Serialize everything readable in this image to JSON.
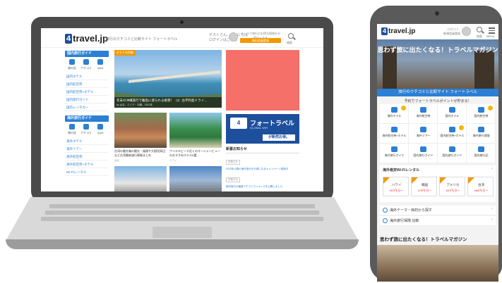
{
  "desktop": {
    "logo_box": "4",
    "logo_text": "travel.jp",
    "tagline": "旅行のクチコミと比較サイト フォートラベル",
    "user_line1": "ゲストさん、こんにちは",
    "user_line2": "ログインはこちら",
    "promo_text": "メールで旅行のお得な情報をお届けします",
    "promo_button": "無料会員登録",
    "search_label": "検索",
    "domestic_guide": "国内旅行ガイド",
    "overseas_guide": "海外旅行ガイド",
    "side_icons": [
      "旅の記",
      "クチコミ",
      "Q&A"
    ],
    "domestic_links": [
      "国内ホテル",
      "国内航空券",
      "国内航空券+ホテル",
      "国内旅行ガイド",
      "国内レンタカー"
    ],
    "overseas_links": [
      "海外ホテル",
      "海外ツアー",
      "海外航空券",
      "海外航空券+ホテル",
      "Wi-Fiレンタル"
    ],
    "hero_tag": "おすすめ特集",
    "hero_caption": "年末の沖縄旅行で離島に渡られる絶景！（3）古宇利島ドライ...",
    "hero_meta": "by はな、エリア：沖縄、2022年",
    "cards": [
      {
        "title": "台湾の最先端の観光・福建や大稲埕周辺など台湾最新旅行情報まとめ",
        "meta": "台北"
      },
      {
        "title": "ワイキキビーチ近くのオーシャンビューのおすすめホテル5選",
        "meta": "ハワイ"
      }
    ],
    "banner_logo": "4",
    "banner_title": "フォートラベル",
    "banner_subtitle": "GLOBAL WIFI",
    "banner_cta": "が断然お得。",
    "news_heading": "新着お知らせ",
    "news_tag": "お知らせ",
    "news_items": [
      "2022年以降の海外旅行がお得になるキャンペーン実施中",
      "国内旅行の最新クチコミランキングを公開しました"
    ]
  },
  "phone": {
    "logo_box": "4",
    "logo_text": "travel.jp",
    "header_login": "ログイン",
    "header_register": "新規会員登録",
    "search_label": "検索",
    "menu_label": "MENU",
    "hero_title": "思わず旅に出たくなる！トラベルマガジン",
    "sub_banner": "旅行のクチコミと比較サイト フォートラベル",
    "point_text": "予約でフォートラベルポイントが貯まる！",
    "services": [
      "海外ホテル",
      "海外航空券",
      "国内ホテル",
      "国内航空券",
      "海外航空券+ホテル",
      "海外ツアー",
      "国内航空券+ホテル",
      "海外旅行保険",
      "海外旅行ガイド",
      "国内旅行ガイド",
      "国内旅行ガイド",
      "国内旅行記"
    ],
    "wifi_heading": "海外格安Wi-Fiレンタル",
    "countries": [
      {
        "name": "ハワイ",
        "price": "597円/日〜"
      },
      {
        "name": "韓国",
        "price": "479円/日〜"
      },
      {
        "name": "アメリカ",
        "price": "597円/日〜"
      },
      {
        "name": "台湾",
        "price": "569円/日〜"
      }
    ],
    "rows": [
      "海外テーマ・目的から探す",
      "海外旅行保険 比較"
    ],
    "magazine_heading": "思わず旅に出たくなる！トラベルマガジン"
  },
  "colors": {
    "accent_blue": "#2b7fd5",
    "brand_navy": "#1d4f9c",
    "promo_orange": "#f39800",
    "ad_red": "#f47069"
  }
}
